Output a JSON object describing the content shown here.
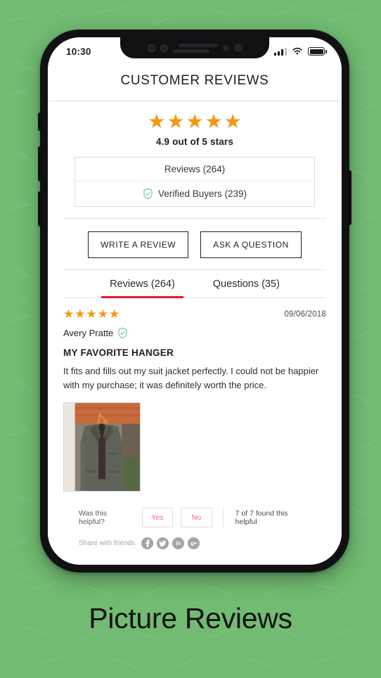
{
  "background": {
    "color": "#71bb72"
  },
  "caption": "Picture Reviews",
  "phone": {
    "status_bar": {
      "time": "10:30",
      "signal_icon": "cellular-signal-icon",
      "wifi_icon": "wifi-icon",
      "battery_icon": "battery-full-icon"
    }
  },
  "header": {
    "title": "CUSTOMER REVIEWS"
  },
  "summary": {
    "stars": 5,
    "star_glyph": "★",
    "star_color": "#f59611",
    "average_text": "4.9 out of 5 stars",
    "reviews_count_label": "Reviews (264)",
    "verified_buyers_label": "Verified Buyers (239)",
    "verified_icon": "verified-shield-icon",
    "verified_icon_color": "#5bb98c"
  },
  "actions": {
    "write_review_label": "WRITE A REVIEW",
    "ask_question_label": "ASK A QUESTION"
  },
  "tabs": {
    "active_index": 0,
    "underline_color": "#e8192c",
    "items": [
      {
        "label": "Reviews (264)"
      },
      {
        "label": "Questions (35)"
      }
    ]
  },
  "review": {
    "stars": 5,
    "date": "09/06/2018",
    "author": "Avery Pratte",
    "verified_icon": "verified-shield-icon",
    "title": "MY FAVORITE HANGER",
    "body": "It fits and fills out my suit jacket perfectly. I could not be happier with my purchase; it was definitely worth the price.",
    "photo_alt": "suit-jacket-on-hanger-photo",
    "helpful": {
      "question": "Was this helpful?",
      "yes_label": "Yes",
      "no_label": "No",
      "count_text": "7 of 7 found this helpful",
      "button_text_color": "#f4607c"
    },
    "share": {
      "label": "Share with friends",
      "networks": [
        {
          "name": "facebook-icon",
          "glyph": "f"
        },
        {
          "name": "twitter-icon",
          "glyph": "t"
        },
        {
          "name": "linkedin-icon",
          "glyph": "in"
        },
        {
          "name": "googleplus-icon",
          "glyph": "g+"
        }
      ]
    }
  }
}
